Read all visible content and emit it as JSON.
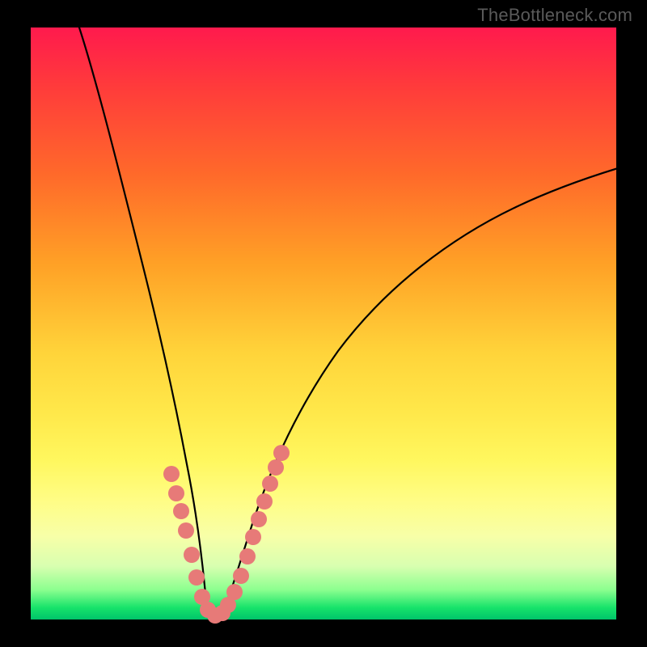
{
  "watermark_text": "TheBottleneck.com",
  "chart_data": {
    "type": "line",
    "title": "",
    "xlabel": "",
    "ylabel": "",
    "xlim": [
      0,
      100
    ],
    "ylim": [
      0,
      100
    ],
    "curve_left": {
      "x": [
        8,
        10,
        12,
        14,
        16,
        18,
        20,
        22,
        24,
        26,
        27,
        28,
        29,
        30
      ],
      "y": [
        100,
        90,
        78,
        66,
        55,
        44,
        34,
        25,
        16,
        9,
        5,
        2.5,
        1,
        0.4
      ]
    },
    "curve_right": {
      "x": [
        30,
        31,
        32,
        34,
        36,
        38,
        40,
        44,
        48,
        54,
        60,
        68,
        76,
        86,
        100
      ],
      "y": [
        0.4,
        0.8,
        1.6,
        4,
        8,
        13,
        18,
        27,
        34,
        43,
        50,
        57,
        63,
        69,
        75
      ]
    },
    "highlight_beads": {
      "comment": "salmon sample markers on the lower V region",
      "x": [
        22.5,
        23.5,
        24.2,
        25.0,
        26.2,
        27.0,
        28.0,
        29.0,
        30.0,
        31.0,
        31.8,
        33.0,
        34.0,
        35.0,
        35.8,
        36.6,
        37.4,
        38.2,
        39.0,
        40.0
      ],
      "y": [
        23,
        19.5,
        17,
        14,
        9.5,
        6.5,
        3.5,
        1.5,
        0.6,
        0.8,
        1.5,
        3,
        5,
        8,
        11,
        14,
        17,
        20,
        23,
        26
      ]
    },
    "gradient_stops": [
      {
        "pos": 0.0,
        "color": "#ff1a4d"
      },
      {
        "pos": 0.55,
        "color": "#ffd43a"
      },
      {
        "pos": 0.8,
        "color": "#fffd86"
      },
      {
        "pos": 1.0,
        "color": "#00c46a"
      }
    ]
  }
}
